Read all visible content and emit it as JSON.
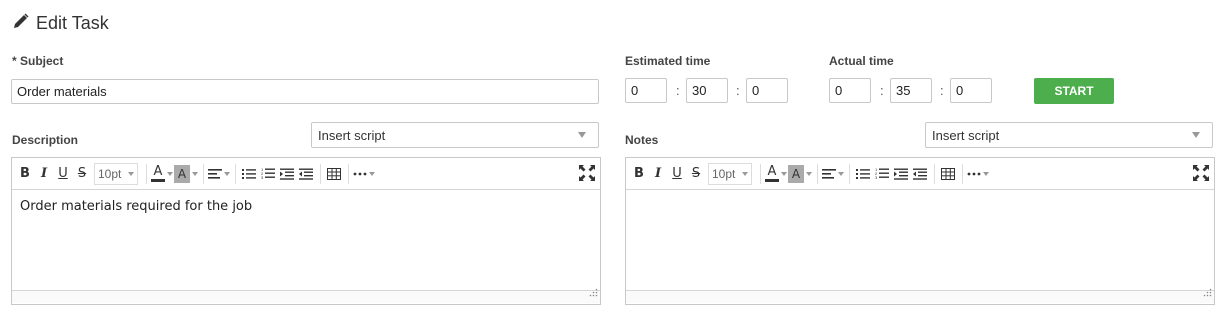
{
  "header": {
    "title": "Edit Task",
    "icon": "pencil-icon"
  },
  "subject": {
    "label": "* Subject",
    "value": "Order materials"
  },
  "estimated_time": {
    "label": "Estimated time",
    "hours": "0",
    "minutes": "30",
    "seconds": "0"
  },
  "actual_time": {
    "label": "Actual time",
    "hours": "0",
    "minutes": "35",
    "seconds": "0"
  },
  "time_separator": ":",
  "start_button": {
    "label": "START",
    "color": "#4cae4c"
  },
  "description": {
    "label": "Description",
    "insert_script": "Insert script",
    "font_size": "10pt",
    "content": "Order materials required for the job"
  },
  "notes": {
    "label": "Notes",
    "insert_script": "Insert script",
    "font_size": "10pt",
    "content": ""
  },
  "toolbar_icons": [
    "bold-icon",
    "italic-icon",
    "underline-icon",
    "strikethrough-icon",
    "font-color-icon",
    "background-color-icon",
    "align-icon",
    "bullet-list-icon",
    "numbered-list-icon",
    "indent-icon",
    "outdent-icon",
    "table-icon",
    "more-icon",
    "fullscreen-icon"
  ]
}
